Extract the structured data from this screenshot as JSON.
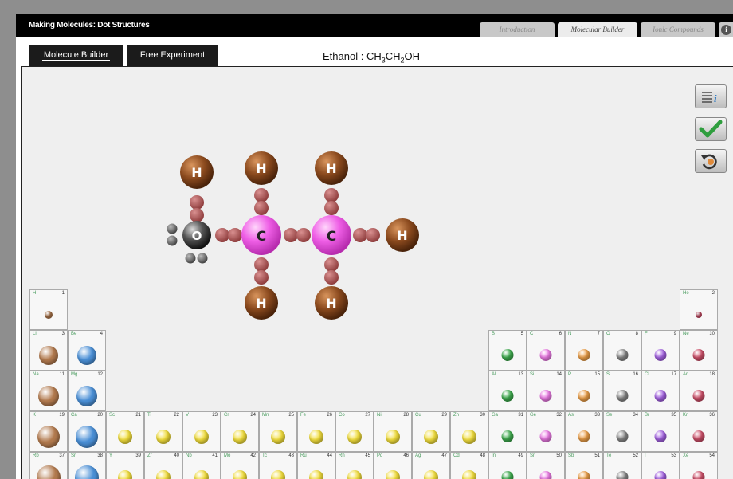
{
  "app_title": "Making Molecules: Dot Structures",
  "top_tabs": [
    {
      "label": "Introduction",
      "active": false
    },
    {
      "label": "Molecular Builder",
      "active": true
    },
    {
      "label": "Ionic Compounds",
      "active": false
    }
  ],
  "info_icon": "i",
  "mode_tabs": {
    "builder": "Molecule Builder",
    "free": "Free Experiment"
  },
  "target": {
    "name": "Ethanol :",
    "formula_parts": [
      "CH",
      "3",
      "CH",
      "2",
      "OH"
    ]
  },
  "side_buttons": [
    "info-list-icon",
    "checkmark-icon",
    "reset-icon"
  ],
  "molecule": {
    "atoms": [
      {
        "symbol": "H"
      },
      {
        "symbol": "H"
      },
      {
        "symbol": "H"
      },
      {
        "symbol": "O"
      },
      {
        "symbol": "C"
      },
      {
        "symbol": "C"
      },
      {
        "symbol": "H"
      },
      {
        "symbol": "H"
      },
      {
        "symbol": "H"
      }
    ]
  },
  "element_colors": {
    "H": "#8b4a1e",
    "C": "#ef5fe6",
    "O": "#555555",
    "bond": "#b35a5a"
  },
  "periodic_table": [
    {
      "sym": "H",
      "num": "1"
    },
    {
      "sym": "He",
      "num": "2"
    },
    {
      "sym": "Li",
      "num": "3"
    },
    {
      "sym": "Be",
      "num": "4"
    },
    {
      "sym": "B",
      "num": "5"
    },
    {
      "sym": "C",
      "num": "6"
    },
    {
      "sym": "N",
      "num": "7"
    },
    {
      "sym": "O",
      "num": "8"
    },
    {
      "sym": "F",
      "num": "9"
    },
    {
      "sym": "Ne",
      "num": "10"
    },
    {
      "sym": "Na",
      "num": "11"
    },
    {
      "sym": "Mg",
      "num": "12"
    },
    {
      "sym": "Al",
      "num": "13"
    },
    {
      "sym": "Si",
      "num": "14"
    },
    {
      "sym": "P",
      "num": "15"
    },
    {
      "sym": "S",
      "num": "16"
    },
    {
      "sym": "Cl",
      "num": "17"
    },
    {
      "sym": "Ar",
      "num": "18"
    },
    {
      "sym": "K",
      "num": "19"
    },
    {
      "sym": "Ca",
      "num": "20"
    },
    {
      "sym": "Sc",
      "num": "21"
    },
    {
      "sym": "Ti",
      "num": "22"
    },
    {
      "sym": "V",
      "num": "23"
    },
    {
      "sym": "Cr",
      "num": "24"
    },
    {
      "sym": "Mn",
      "num": "25"
    },
    {
      "sym": "Fe",
      "num": "26"
    },
    {
      "sym": "Co",
      "num": "27"
    },
    {
      "sym": "Ni",
      "num": "28"
    },
    {
      "sym": "Cu",
      "num": "29"
    },
    {
      "sym": "Zn",
      "num": "30"
    },
    {
      "sym": "Ga",
      "num": "31"
    },
    {
      "sym": "Ge",
      "num": "32"
    },
    {
      "sym": "As",
      "num": "33"
    },
    {
      "sym": "Se",
      "num": "34"
    },
    {
      "sym": "Br",
      "num": "35"
    },
    {
      "sym": "Kr",
      "num": "36"
    },
    {
      "sym": "Rb",
      "num": "37"
    },
    {
      "sym": "Sr",
      "num": "38"
    },
    {
      "sym": "Y",
      "num": "39"
    },
    {
      "sym": "Zr",
      "num": "40"
    },
    {
      "sym": "Nb",
      "num": "41"
    },
    {
      "sym": "Mo",
      "num": "42"
    },
    {
      "sym": "Tc",
      "num": "43"
    },
    {
      "sym": "Ru",
      "num": "44"
    },
    {
      "sym": "Rh",
      "num": "45"
    },
    {
      "sym": "Pd",
      "num": "46"
    },
    {
      "sym": "Ag",
      "num": "47"
    },
    {
      "sym": "Cd",
      "num": "48"
    },
    {
      "sym": "In",
      "num": "49"
    },
    {
      "sym": "Sn",
      "num": "50"
    },
    {
      "sym": "Sb",
      "num": "51"
    },
    {
      "sym": "Te",
      "num": "52"
    },
    {
      "sym": "I",
      "num": "53"
    },
    {
      "sym": "Xe",
      "num": "54"
    }
  ]
}
